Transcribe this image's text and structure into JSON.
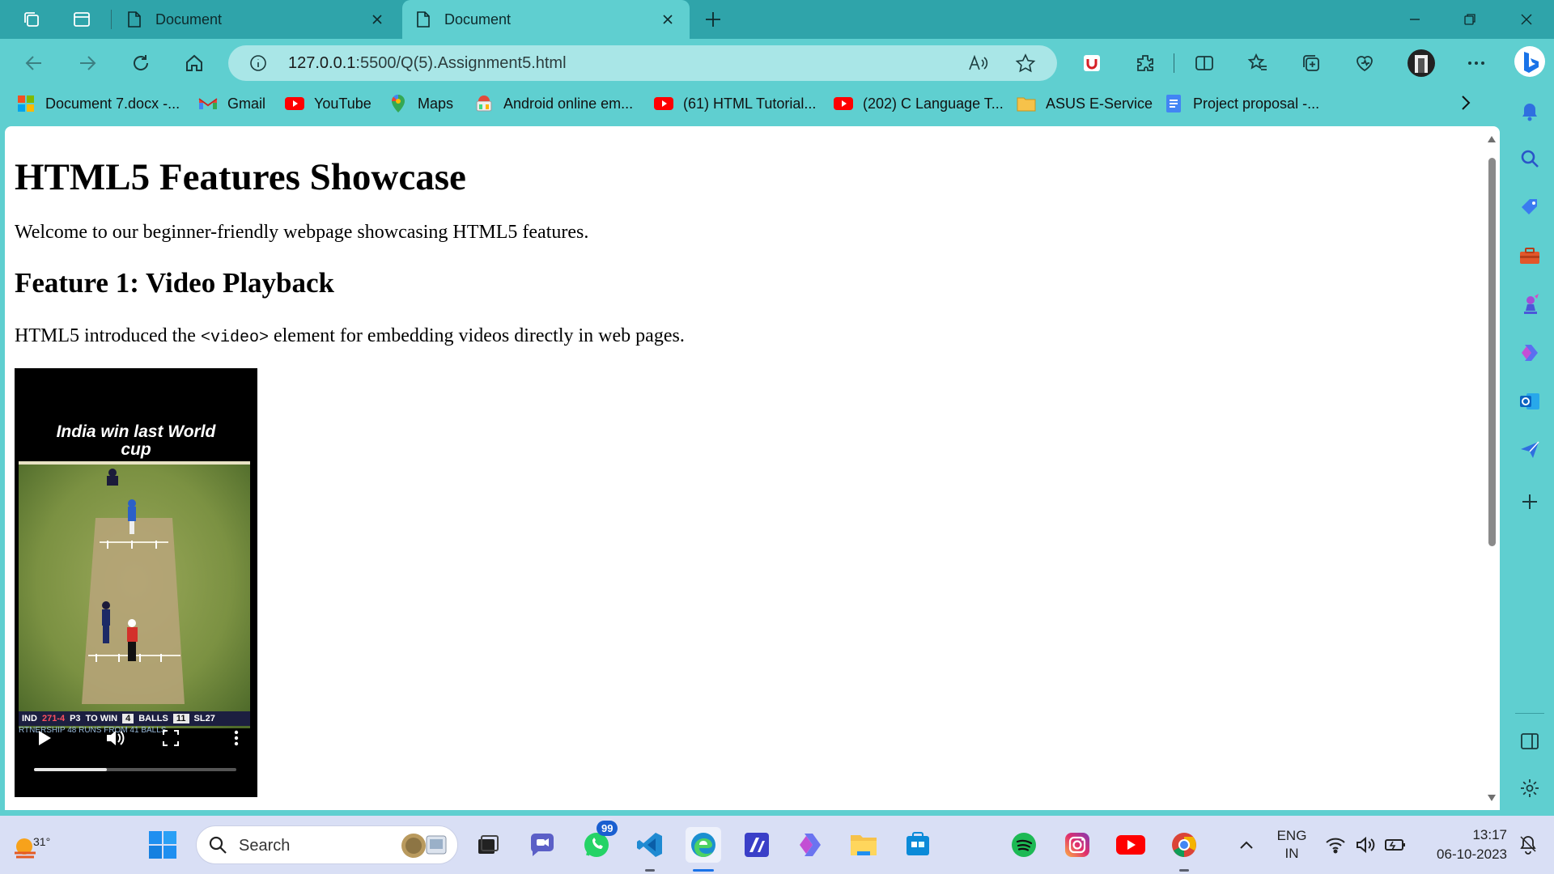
{
  "browser": {
    "tabs": [
      {
        "title": "Document",
        "active": false
      },
      {
        "title": "Document",
        "active": true
      }
    ],
    "address": {
      "host": "127.0.0.1",
      "path": ":5500/Q(5).Assignment5.html"
    },
    "bookmarks": [
      {
        "label": "Document 7.docx -...",
        "icon": "microsoft-icon"
      },
      {
        "label": "Gmail",
        "icon": "gmail-icon"
      },
      {
        "label": "YouTube",
        "icon": "youtube-icon"
      },
      {
        "label": "Maps",
        "icon": "maps-icon"
      },
      {
        "label": "Android online em...",
        "icon": "android-icon"
      },
      {
        "label": "(61) HTML Tutorial...",
        "icon": "youtube-icon"
      },
      {
        "label": "(202) C Language T...",
        "icon": "youtube-icon"
      },
      {
        "label": "ASUS E-Service",
        "icon": "folder-icon"
      },
      {
        "label": "Project proposal -...",
        "icon": "docs-icon"
      }
    ]
  },
  "page": {
    "heading": "HTML5 Features Showcase",
    "intro": "Welcome to our beginner-friendly webpage showcasing HTML5 features.",
    "feature1": {
      "heading": "Feature 1: Video Playback",
      "desc_before": "HTML5 introduced the ",
      "desc_code": "<video>",
      "desc_after": " element for embedding videos directly in web pages."
    },
    "video": {
      "caption_line1": "India win last World",
      "caption_line2": "cup",
      "score": {
        "team": "IND",
        "runs": "271-4",
        "p": "P3",
        "to_win_label": "TO WIN",
        "to_win": "4",
        "balls_label": "BALLS",
        "balls": "11",
        "other": "SL27"
      },
      "partnership": "RTNERSHIP 48 RUNS FROM 41 BALLS",
      "progress": 0.36
    }
  },
  "taskbar": {
    "weather_temp": "31°",
    "search_placeholder": "Search",
    "whatsapp_badge": "99",
    "lang_line1": "ENG",
    "lang_line2": "IN",
    "time": "13:17",
    "date": "06-10-2023"
  },
  "colors": {
    "tabstrip": "#2fa4aa",
    "toolbar": "#5fcfd0",
    "addressbar": "#a9e6e7",
    "taskbar": "#d9dff5"
  }
}
